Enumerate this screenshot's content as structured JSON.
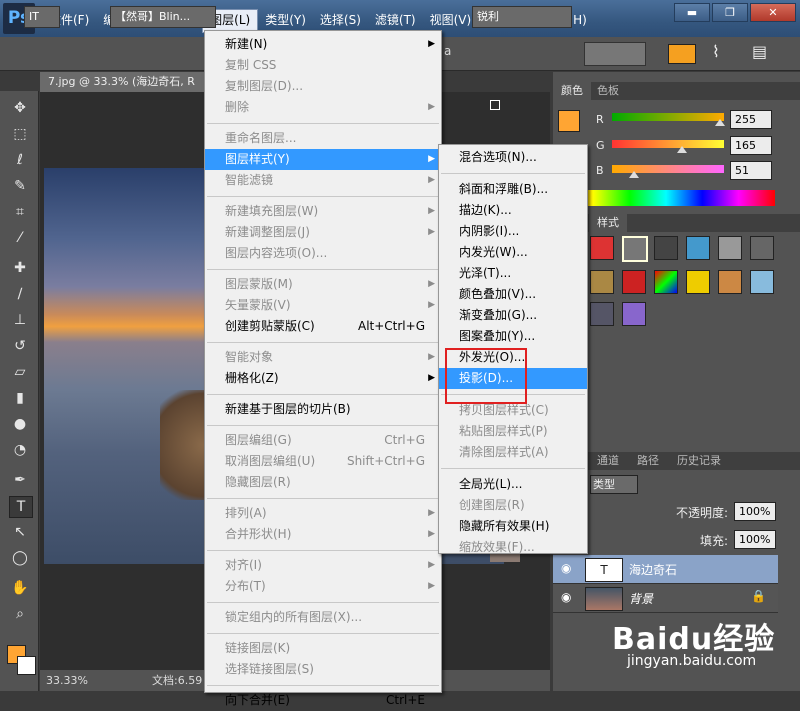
{
  "title_bar": {
    "logo": "Ps",
    "window_buttons": [
      "▬",
      "❐",
      "✕"
    ]
  },
  "menu_bar": [
    {
      "label": "文件(F)"
    },
    {
      "label": "编辑(E)"
    },
    {
      "label": "图像(I)"
    },
    {
      "label": "图层(L)",
      "active": true
    },
    {
      "label": "类型(Y)"
    },
    {
      "label": "选择(S)"
    },
    {
      "label": "滤镜(T)"
    },
    {
      "label": "视图(V)"
    },
    {
      "label": "窗口(W)"
    },
    {
      "label": "帮助(H)"
    }
  ],
  "options_bar": {
    "tool_glyph": "IT",
    "font_name": "【然哥】Blin...",
    "size_prefix": "a",
    "antialias": "锐利",
    "accent": "#f5a020"
  },
  "document": {
    "tab_title": "7.jpg @ 33.3% (海边奇石, R",
    "zoom": "33.33%",
    "doc_label": "文档:6.59"
  },
  "layer_menu": {
    "items": [
      {
        "label": "新建(N)",
        "arrow": true
      },
      {
        "label": "复制 CSS",
        "disabled": true
      },
      {
        "label": "复制图层(D)...",
        "disabled": true
      },
      {
        "label": "删除",
        "disabled": true,
        "arrow": true
      },
      {
        "sep": true
      },
      {
        "label": "重命名图层...",
        "disabled": true
      },
      {
        "label": "图层样式(Y)",
        "arrow": true,
        "highlighted": true
      },
      {
        "label": "智能滤镜",
        "disabled": true,
        "arrow": true
      },
      {
        "sep": true
      },
      {
        "label": "新建填充图层(W)",
        "disabled": true,
        "arrow": true
      },
      {
        "label": "新建调整图层(J)",
        "disabled": true,
        "arrow": true
      },
      {
        "label": "图层内容选项(O)...",
        "disabled": true
      },
      {
        "sep": true
      },
      {
        "label": "图层蒙版(M)",
        "disabled": true,
        "arrow": true
      },
      {
        "label": "矢量蒙版(V)",
        "disabled": true,
        "arrow": true
      },
      {
        "label": "创建剪贴蒙版(C)",
        "shortcut": "Alt+Ctrl+G"
      },
      {
        "sep": true
      },
      {
        "label": "智能对象",
        "disabled": true,
        "arrow": true
      },
      {
        "label": "栅格化(Z)",
        "arrow": true
      },
      {
        "sep": true
      },
      {
        "label": "新建基于图层的切片(B)"
      },
      {
        "sep": true
      },
      {
        "label": "图层编组(G)",
        "disabled": true,
        "shortcut": "Ctrl+G"
      },
      {
        "label": "取消图层编组(U)",
        "disabled": true,
        "shortcut": "Shift+Ctrl+G"
      },
      {
        "label": "隐藏图层(R)",
        "disabled": true
      },
      {
        "sep": true
      },
      {
        "label": "排列(A)",
        "disabled": true,
        "arrow": true
      },
      {
        "label": "合并形状(H)",
        "disabled": true,
        "arrow": true
      },
      {
        "sep": true
      },
      {
        "label": "对齐(I)",
        "disabled": true,
        "arrow": true
      },
      {
        "label": "分布(T)",
        "disabled": true,
        "arrow": true
      },
      {
        "sep": true
      },
      {
        "label": "锁定组内的所有图层(X)...",
        "disabled": true
      },
      {
        "sep": true
      },
      {
        "label": "链接图层(K)",
        "disabled": true
      },
      {
        "label": "选择链接图层(S)",
        "disabled": true
      },
      {
        "sep": true
      },
      {
        "label": "向下合并(E)",
        "shortcut": "Ctrl+E"
      }
    ]
  },
  "style_submenu": {
    "items": [
      {
        "label": "混合选项(N)..."
      },
      {
        "sep": true
      },
      {
        "label": "斜面和浮雕(B)..."
      },
      {
        "label": "描边(K)..."
      },
      {
        "label": "内阴影(I)..."
      },
      {
        "label": "内发光(W)..."
      },
      {
        "label": "光泽(T)..."
      },
      {
        "label": "颜色叠加(V)..."
      },
      {
        "label": "渐变叠加(G)..."
      },
      {
        "label": "图案叠加(Y)..."
      },
      {
        "label": "外发光(O)..."
      },
      {
        "label": "投影(D)...",
        "highlighted": true
      },
      {
        "sep": true
      },
      {
        "label": "拷贝图层样式(C)",
        "disabled": true
      },
      {
        "label": "粘贴图层样式(P)",
        "disabled": true
      },
      {
        "label": "清除图层样式(A)",
        "disabled": true
      },
      {
        "sep": true
      },
      {
        "label": "全局光(L)..."
      },
      {
        "label": "创建图层(R)",
        "disabled": true
      },
      {
        "label": "隐藏所有效果(H)"
      },
      {
        "label": "缩放效果(F)...",
        "disabled": true
      }
    ]
  },
  "color_panel": {
    "tabs": [
      "颜色",
      "色板"
    ],
    "channels": [
      {
        "label": "R",
        "value": "255",
        "fraction": 1.0
      },
      {
        "label": "G",
        "value": "165",
        "fraction": 0.647
      },
      {
        "label": "B",
        "value": "51",
        "fraction": 0.2
      }
    ],
    "swatch": "#ffa533"
  },
  "styles_panel": {
    "tab": "样式"
  },
  "layers_panel": {
    "tabs": [
      "通道",
      "路径",
      "历史记录"
    ],
    "kind_label": "类型",
    "opacity_label": "不透明度:",
    "opacity": "100%",
    "fill_label": "填充:",
    "fill": "100%",
    "layers": [
      {
        "name": "海边奇石",
        "type": "text",
        "selected": true
      },
      {
        "name": "背景",
        "type": "image",
        "locked": true
      }
    ]
  },
  "watermark": {
    "brand": "Baidu经验",
    "url": "jingyan.baidu.com"
  }
}
